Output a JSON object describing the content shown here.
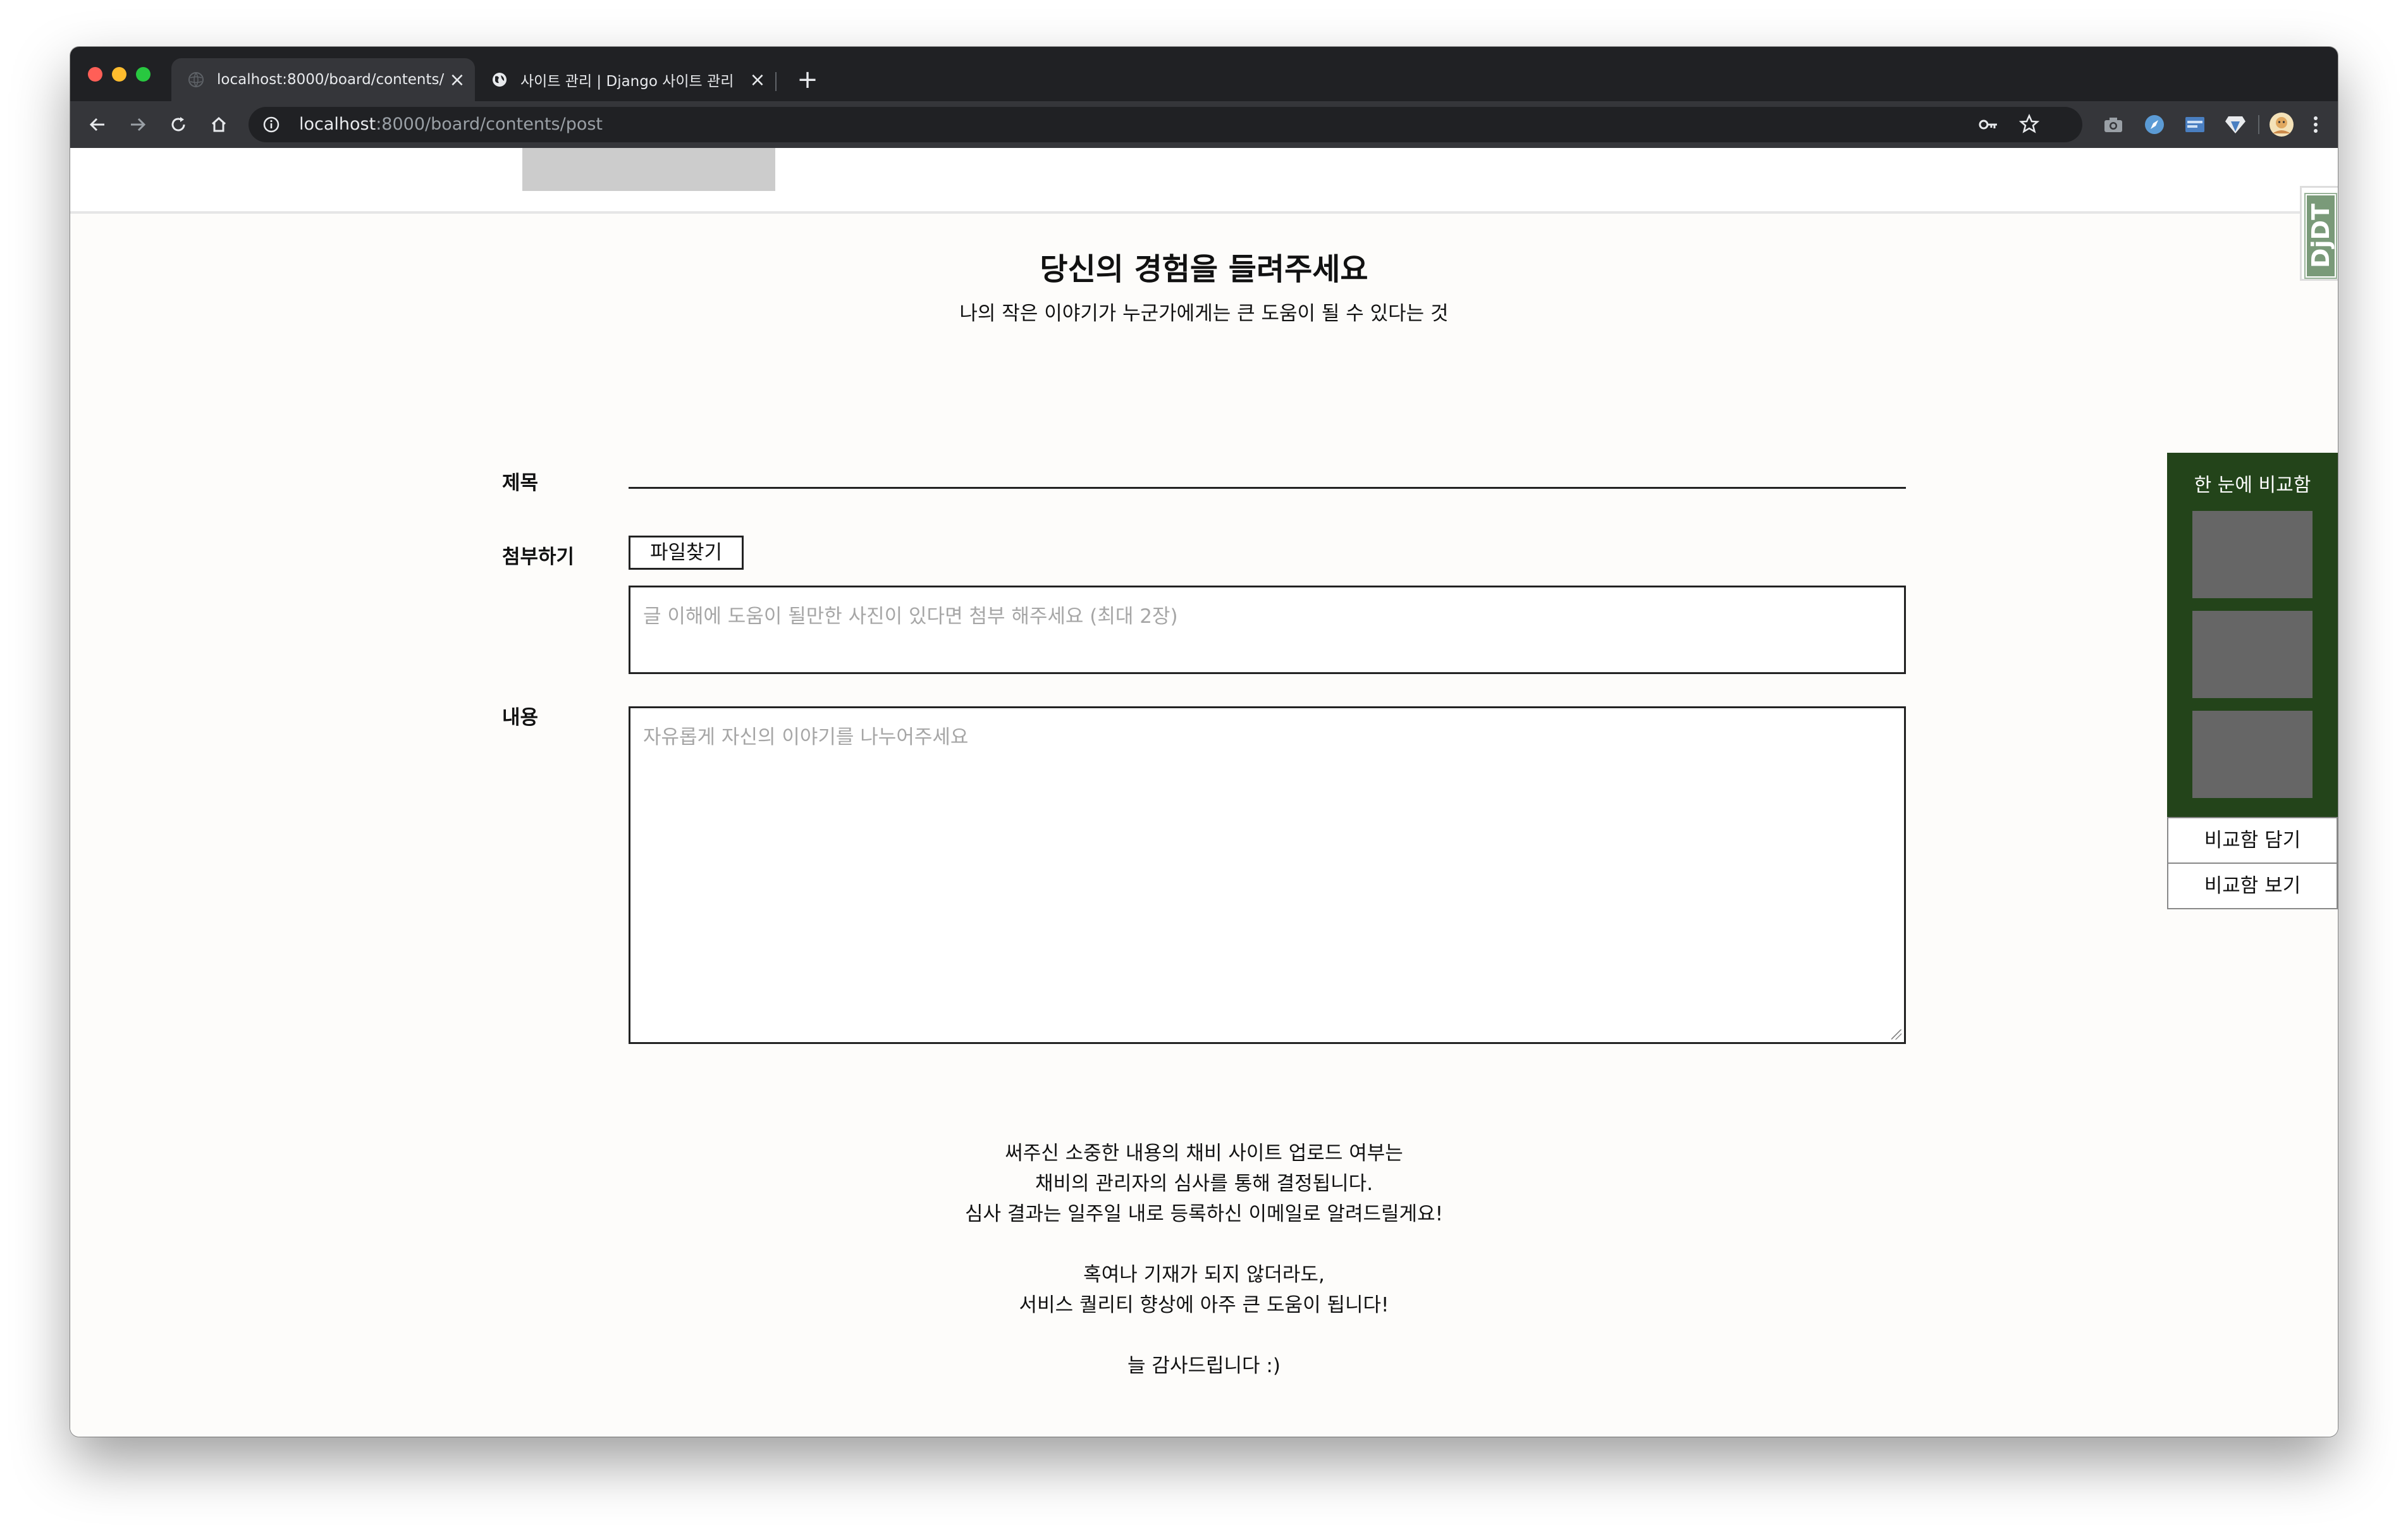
{
  "browser": {
    "tabs": [
      {
        "title": "localhost:8000/board/contents/post",
        "active": true
      },
      {
        "title": "사이트 관리 | Django 사이트 관리",
        "active": false
      }
    ],
    "url_host": "localhost",
    "url_path": ":8000/board/contents/post",
    "traffic_colors": [
      "#ff5f57",
      "#febc2e",
      "#28c840"
    ]
  },
  "debug_toolbar": {
    "label": "DjDT"
  },
  "page": {
    "title": "당신의 경험을 들려주세요",
    "subtitle": "나의 작은 이야기가 누군가에게는 큰 도움이 될 수 있다는 것"
  },
  "form": {
    "title_label": "제목",
    "title_value": "",
    "attach_label": "첨부하기",
    "file_button": "파일찾기",
    "attach_placeholder": "글 이해에 도움이 될만한 사진이 있다면 첨부 해주세요 (최대 2장)",
    "content_label": "내용",
    "content_placeholder": "자유롭게 자신의 이야기를 나누어주세요"
  },
  "notice": {
    "lines": [
      "써주신 소중한 내용의 채비 사이트 업로드 여부는",
      "채비의 관리자의 심사를 통해 결정됩니다.",
      "심사 결과는 일주일 내로 등록하신 이메일로 알려드릴게요!",
      "",
      "혹여나 기재가 되지 않더라도,",
      "서비스 퀄리티 향상에 아주 큰 도움이 됩니다!",
      "",
      "늘 감사드립니다 :)"
    ]
  },
  "compare": {
    "title": "한 눈에 비교함",
    "add_button": "비교함 담기",
    "view_button": "비교함 보기",
    "panel_color": "#23441a"
  }
}
